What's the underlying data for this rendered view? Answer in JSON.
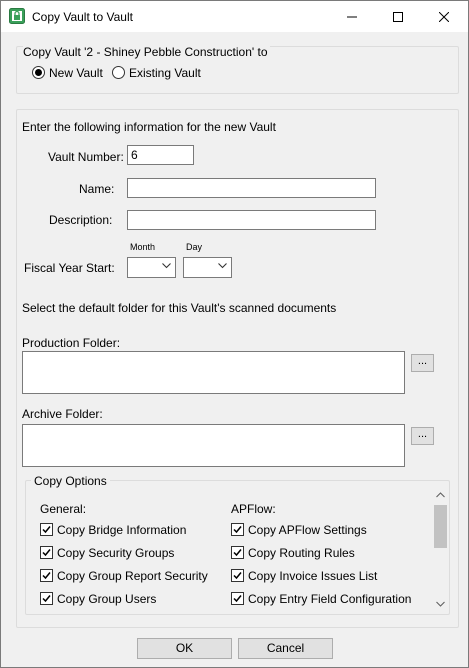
{
  "window": {
    "title": "Copy Vault to Vault"
  },
  "copy_header": {
    "label": "Copy Vault '2 - Shiney Pebble Construction' to",
    "new_vault": "New Vault",
    "existing_vault": "Existing Vault",
    "selected": "New Vault"
  },
  "form": {
    "instructions": "Enter the following information for the new Vault",
    "vault_number_label": "Vault Number:",
    "vault_number_value": "6",
    "name_label": "Name:",
    "name_value": "",
    "description_label": "Description:",
    "description_value": "",
    "fiscal_year_label": "Fiscal Year Start:",
    "month_label": "Month",
    "day_label": "Day",
    "month_value": "",
    "day_value": "",
    "folder_instructions": "Select the default folder for this Vault's scanned documents",
    "production_label": "Production Folder:",
    "production_value": "",
    "archive_label": "Archive Folder:",
    "archive_value": "",
    "browse_label": "..."
  },
  "copy_options": {
    "title": "Copy Options",
    "general_heading": "General:",
    "apflow_heading": "APFlow:",
    "general_items": [
      {
        "label": "Copy Bridge Information",
        "checked": true
      },
      {
        "label": "Copy Security Groups",
        "checked": true
      },
      {
        "label": "Copy Group Report Security",
        "checked": true
      },
      {
        "label": "Copy Group Users",
        "checked": true
      }
    ],
    "apflow_items": [
      {
        "label": "Copy APFlow Settings",
        "checked": true
      },
      {
        "label": "Copy Routing Rules",
        "checked": true
      },
      {
        "label": "Copy Invoice Issues List",
        "checked": true
      },
      {
        "label": "Copy Entry Field Configuration",
        "checked": true
      }
    ]
  },
  "buttons": {
    "ok_label": "OK",
    "cancel_label": "Cancel"
  }
}
